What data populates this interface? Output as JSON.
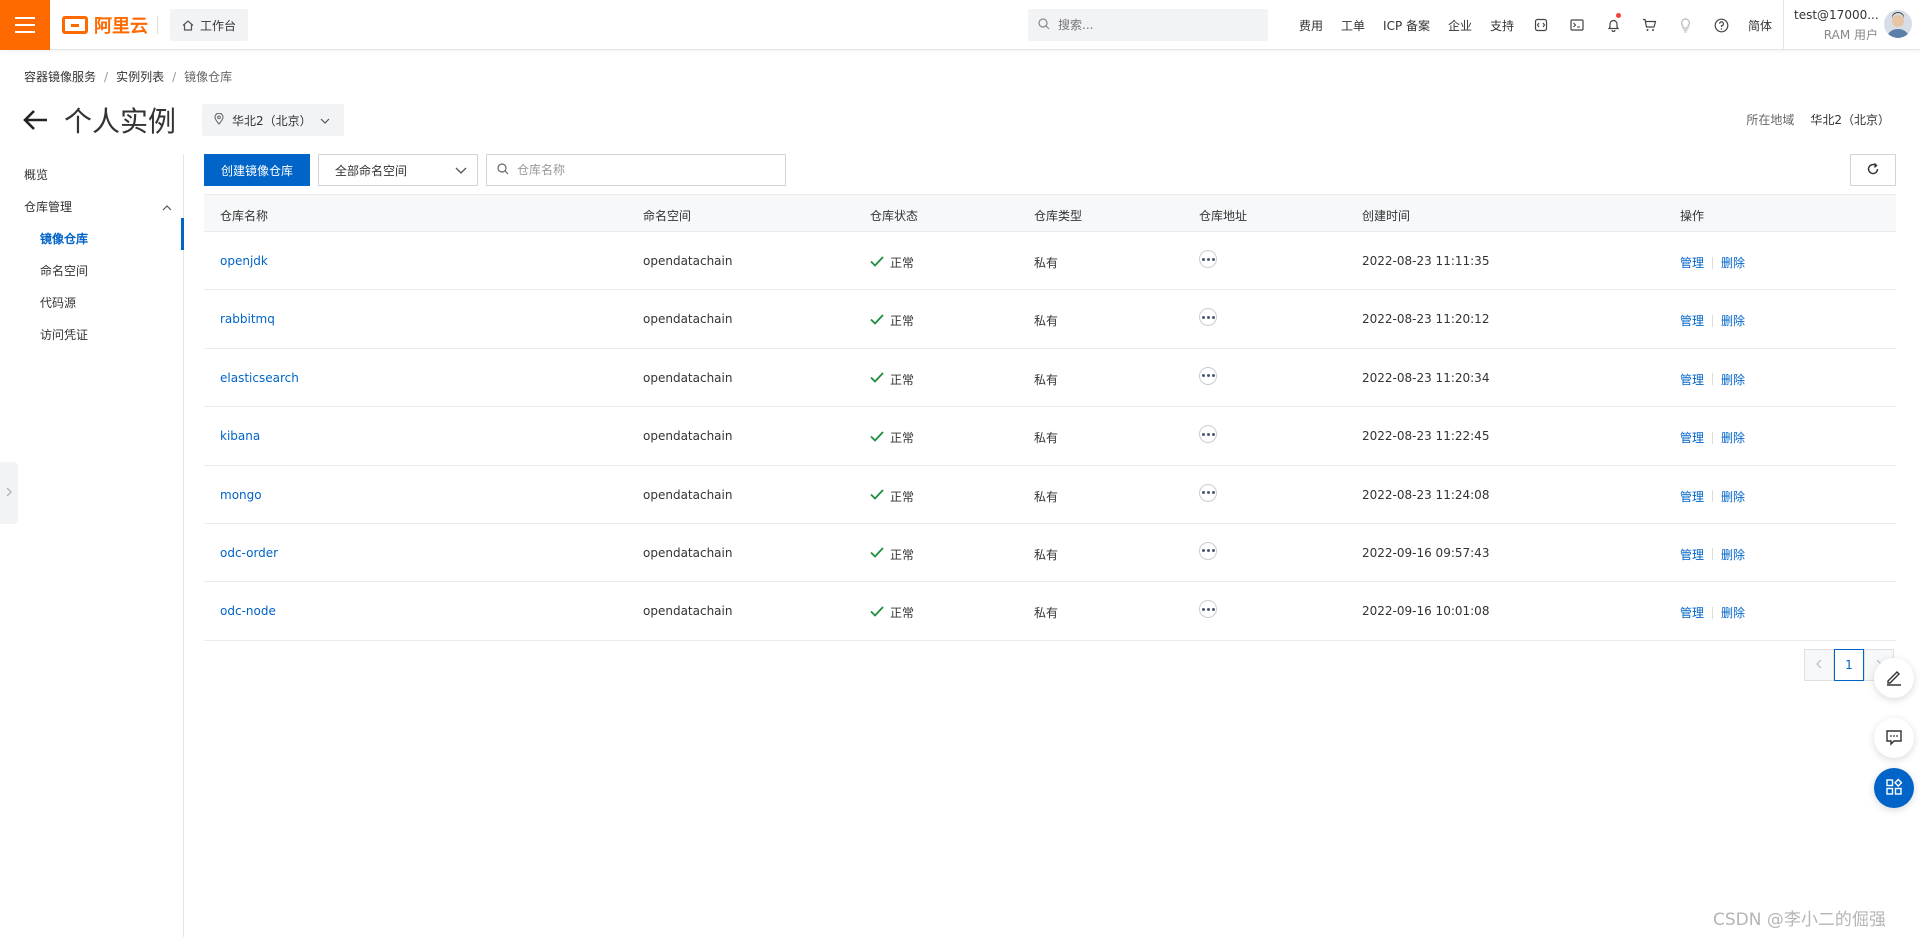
{
  "header": {
    "brand": "阿里云",
    "workbench": "工作台",
    "search_placeholder": "搜索...",
    "nav": [
      "费用",
      "工单",
      "ICP 备案",
      "企业",
      "支持"
    ],
    "lang": "简体",
    "user_name": "test@17000...",
    "user_role": "RAM 用户",
    "accent": "#ff6a00"
  },
  "breadcrumb": [
    "容器镜像服务",
    "实例列表",
    "镜像仓库"
  ],
  "page": {
    "title": "个人实例",
    "region": "华北2（北京）",
    "region_label": "所在地域",
    "region_value": "华北2（北京）"
  },
  "sidebar": {
    "overview": "概览",
    "repo_mgmt": "仓库管理",
    "items": [
      "镜像仓库",
      "命名空间",
      "代码源",
      "访问凭证"
    ]
  },
  "toolbar": {
    "create_label": "创建镜像仓库",
    "namespace_select": "全部命名空间",
    "search_placeholder": "仓库名称"
  },
  "table": {
    "columns": [
      "仓库名称",
      "命名空间",
      "仓库状态",
      "仓库类型",
      "仓库地址",
      "创建时间",
      "操作"
    ],
    "rows": [
      {
        "name": "openjdk",
        "namespace": "opendatachain",
        "status": "正常",
        "type": "私有",
        "created": "2022-08-23 11:11:35"
      },
      {
        "name": "rabbitmq",
        "namespace": "opendatachain",
        "status": "正常",
        "type": "私有",
        "created": "2022-08-23 11:20:12"
      },
      {
        "name": "elasticsearch",
        "namespace": "opendatachain",
        "status": "正常",
        "type": "私有",
        "created": "2022-08-23 11:20:34"
      },
      {
        "name": "kibana",
        "namespace": "opendatachain",
        "status": "正常",
        "type": "私有",
        "created": "2022-08-23 11:22:45"
      },
      {
        "name": "mongo",
        "namespace": "opendatachain",
        "status": "正常",
        "type": "私有",
        "created": "2022-08-23 11:24:08"
      },
      {
        "name": "odc-order",
        "namespace": "opendatachain",
        "status": "正常",
        "type": "私有",
        "created": "2022-09-16 09:57:43"
      },
      {
        "name": "odc-node",
        "namespace": "opendatachain",
        "status": "正常",
        "type": "私有",
        "created": "2022-09-16 10:01:08"
      }
    ],
    "op_manage": "管理",
    "op_delete": "删除"
  },
  "pagination": {
    "current": "1"
  },
  "watermark": "CSDN @李小二的倔强",
  "colors": {
    "primary": "#0064c8",
    "success": "#1e8e3e"
  }
}
